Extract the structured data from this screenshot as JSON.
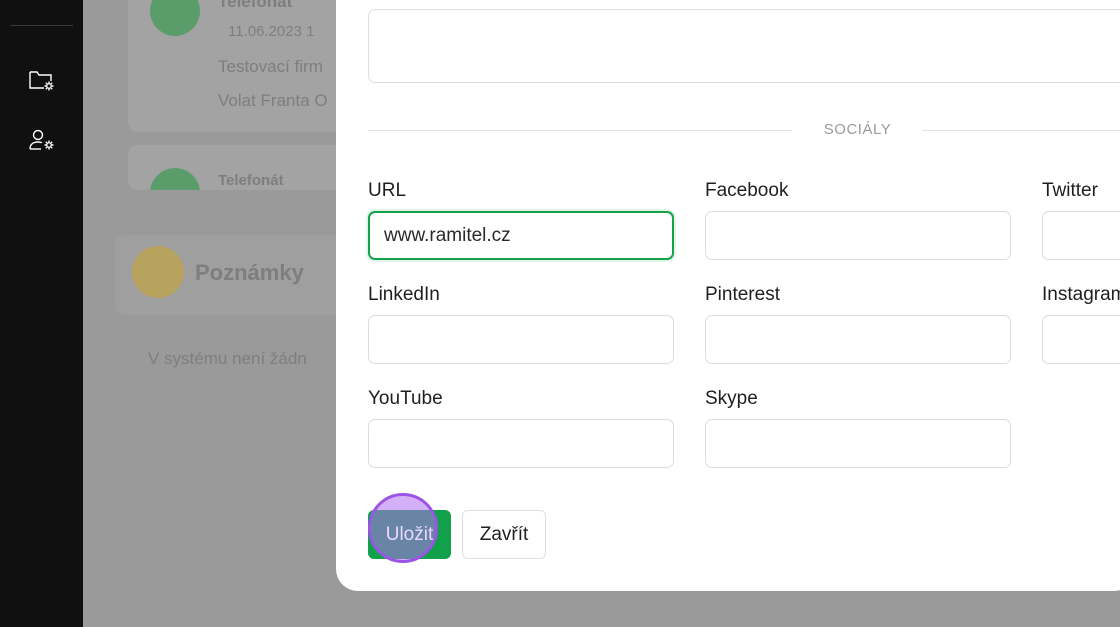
{
  "background": {
    "card_text_1": "Telefonát",
    "card_text_2": "11.06.2023 1",
    "card_text_3": "Testovací firm",
    "card_text_4": "Volat Franta O",
    "card_text_5": "Telefonát",
    "notes_title": "Poznámky",
    "notes_empty": "V systému není žádn"
  },
  "modal": {
    "section_title": "SOCIÁLY",
    "fields": {
      "url": {
        "label": "URL",
        "value": "www.ramitel.cz"
      },
      "facebook": {
        "label": "Facebook",
        "value": ""
      },
      "twitter": {
        "label": "Twitter",
        "value": ""
      },
      "linkedin": {
        "label": "LinkedIn",
        "value": ""
      },
      "pinterest": {
        "label": "Pinterest",
        "value": ""
      },
      "instagram": {
        "label": "Instagram",
        "value": ""
      },
      "youtube": {
        "label": "YouTube",
        "value": ""
      },
      "skype": {
        "label": "Skype",
        "value": ""
      }
    },
    "save_label": "Uložit",
    "close_label": "Zavřít"
  },
  "colors": {
    "accent": "#12a04a",
    "focus_border": "#14a34a",
    "sidebar": "#101010",
    "overlay": "#9a9a9a"
  },
  "icons": {
    "sidebar_1": "folder-settings-icon",
    "sidebar_2": "user-settings-icon"
  }
}
